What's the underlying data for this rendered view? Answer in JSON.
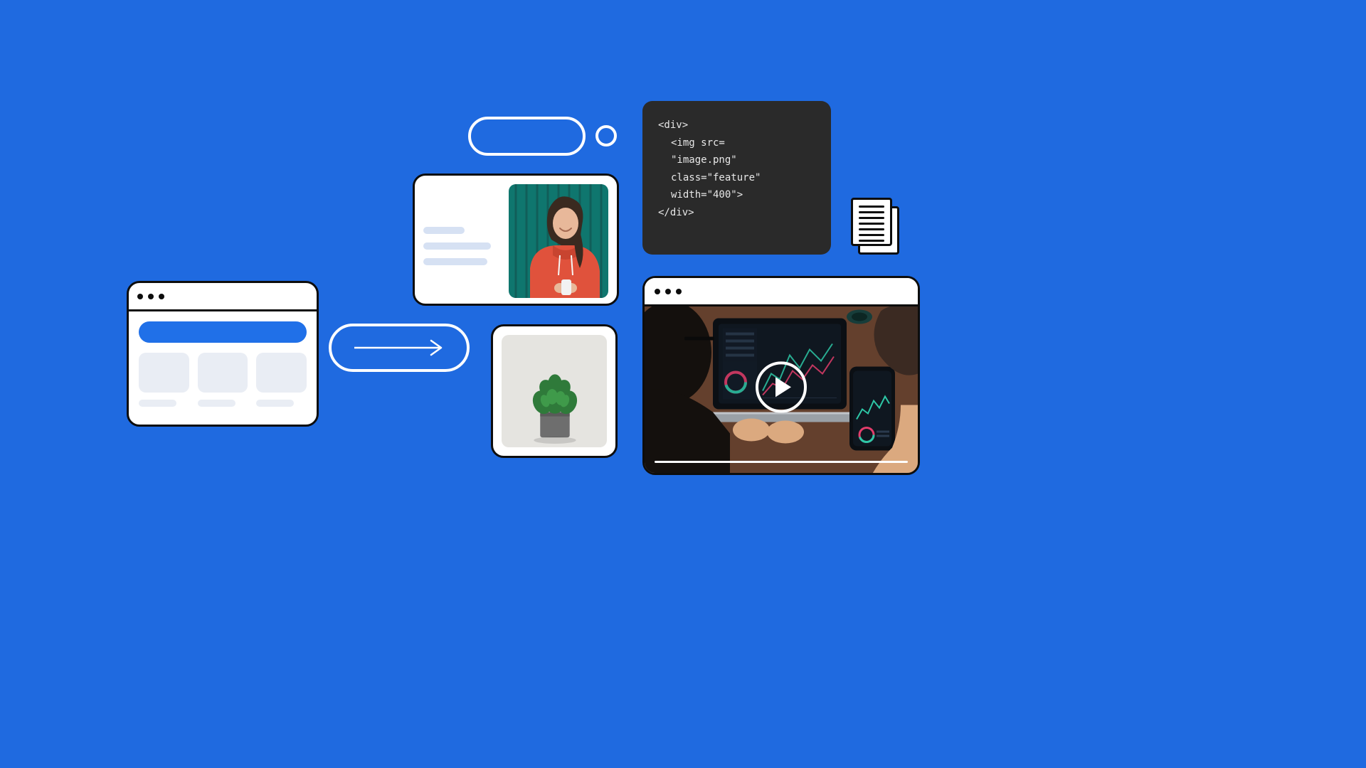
{
  "code": {
    "line1": "<div>",
    "line2": "<img src=",
    "line3": "\"image.png\"",
    "line4": "class=\"feature\"",
    "line5": "width=\"400\">",
    "line6": "</div>"
  }
}
